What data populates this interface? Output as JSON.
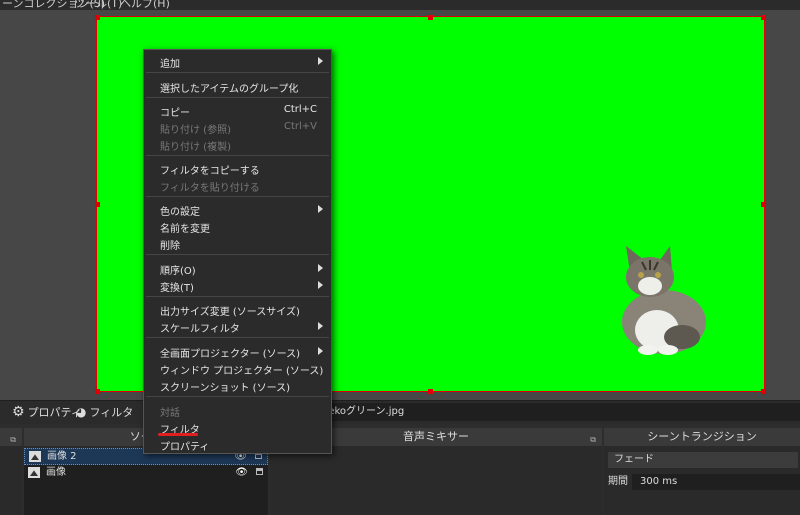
{
  "menubar": {
    "item1": "ーンコレクション(S)",
    "item2": "ツール(T)",
    "item3": "ヘルプ(H)"
  },
  "toolbar": {
    "properties": "プロパティ",
    "filters": "フィルタ",
    "filename": "nekoグリーン.jpg"
  },
  "context_menu": {
    "add": "追加",
    "group": "選択したアイテムのグループ化",
    "copy": "コピー",
    "copy_shortcut": "Ctrl+C",
    "paste_ref": "貼り付け (参照)",
    "paste_ref_shortcut": "Ctrl+V",
    "paste_dup": "貼り付け (複製)",
    "copy_filters": "フィルタをコピーする",
    "paste_filters": "フィルタを貼り付ける",
    "color": "色の設定",
    "rename": "名前を変更",
    "delete": "削除",
    "order": "順序(O)",
    "transform": "変換(T)",
    "resize_output": "出力サイズ変更 (ソースサイズ)",
    "scale_filter": "スケールフィルタ",
    "fullscreen_projector": "全画面プロジェクター (ソース)",
    "window_projector": "ウィンドウ プロジェクター (ソース)",
    "screenshot": "スクリーンショット (ソース)",
    "interact": "対話",
    "filters": "フィルタ",
    "properties": "プロパティ"
  },
  "sources": {
    "title": "ソース",
    "items": [
      {
        "name": "画像 2"
      },
      {
        "name": "画像"
      }
    ]
  },
  "mixer": {
    "title": "音声ミキサー"
  },
  "transitions": {
    "title": "シーントランジション",
    "selected": "フェード",
    "duration_label": "期間",
    "duration_value": "300 ms"
  }
}
